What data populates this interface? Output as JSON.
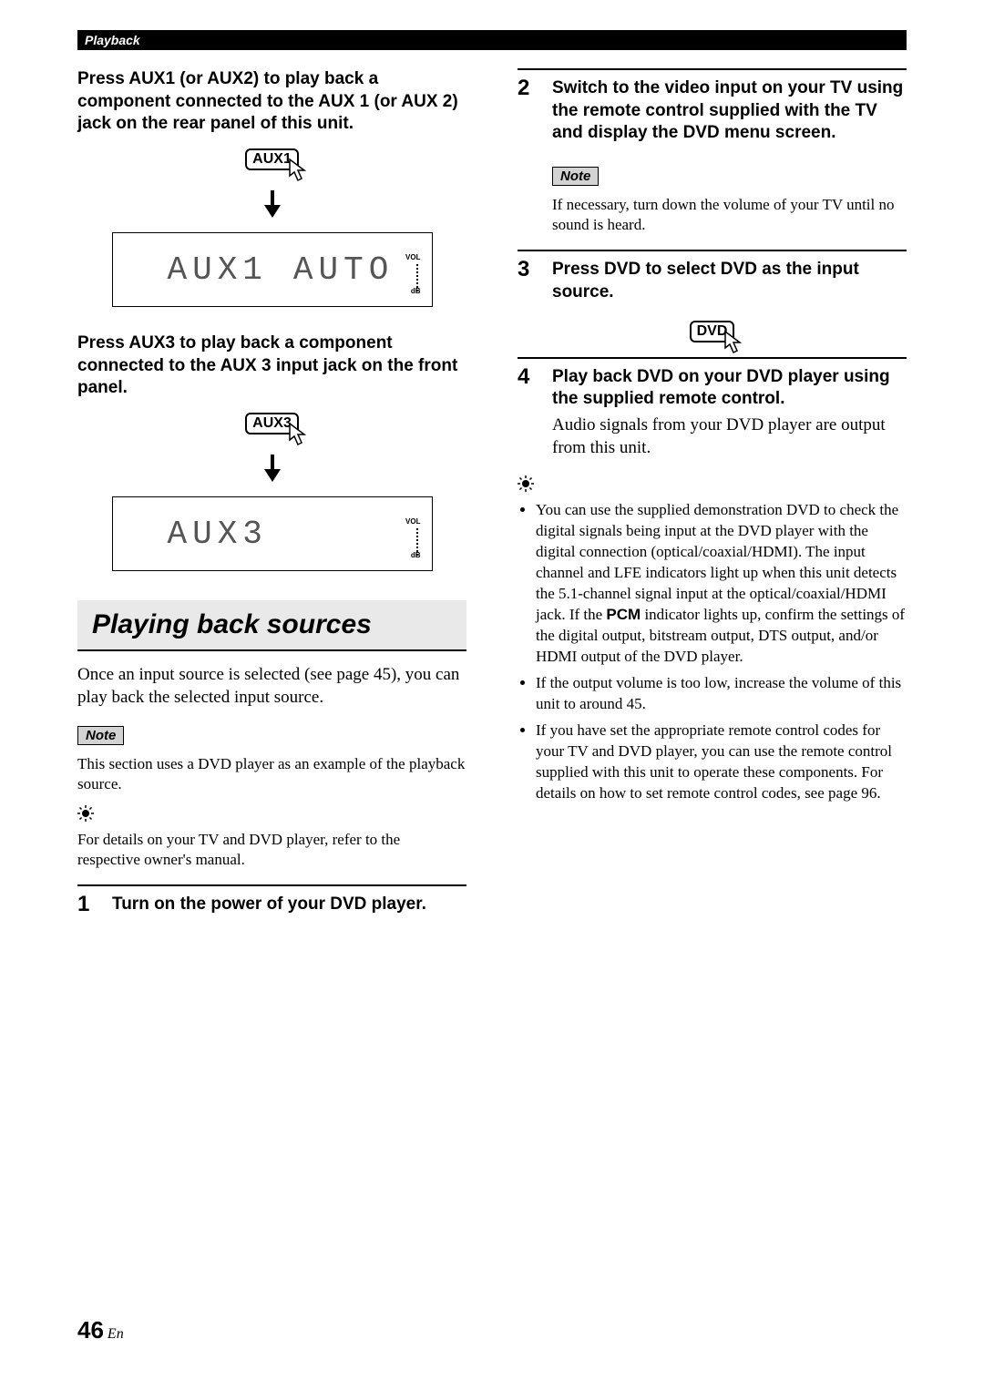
{
  "header": {
    "section": "Playback"
  },
  "left": {
    "instr1": "Press AUX1 (or AUX2) to play back a component connected to the AUX 1 (or AUX 2) jack on the rear panel of this unit.",
    "btn1": "AUX1",
    "disp1_a": "AUX1",
    "disp1_b": "AUTO",
    "vol_label": "VOL",
    "vol_db": "dB",
    "instr2": "Press AUX3 to play back a component connected to the AUX 3 input jack on the front panel.",
    "btn2": "AUX3",
    "disp2_a": "AUX3",
    "section_title": "Playing back sources",
    "intro": "Once an input source is selected (see page 45), you can play back the selected input source.",
    "note_label": "Note",
    "note_text": "This section uses a DVD player as an example of the playback source.",
    "tip_text": "For details on your TV and DVD player, refer to the respective owner's manual.",
    "step1_num": "1",
    "step1_text": "Turn on the power of your DVD player."
  },
  "right": {
    "step2_num": "2",
    "step2_text": "Switch to the video input on your TV using the remote control supplied with the TV and display the DVD menu screen.",
    "note_label": "Note",
    "note_text": "If necessary, turn down the volume of your TV until no sound is heard.",
    "step3_num": "3",
    "step3_text": "Press DVD to select DVD as the input source.",
    "btn_dvd": "DVD",
    "step4_num": "4",
    "step4_text": "Play back DVD on your DVD player using the supplied remote control.",
    "step4_sub": "Audio signals from your DVD player are output from this unit.",
    "tips": [
      {
        "pre": "You can use the supplied demonstration DVD to check the digital signals being input at the DVD player with the digital connection (optical/coaxial/HDMI). The input channel and LFE indicators light up when this unit detects the 5.1-channel signal input at the optical/coaxial/HDMI jack. If the ",
        "pcm": "PCM",
        "post": " indicator lights up, confirm the settings of the digital output, bitstream output, DTS output, and/or HDMI output of the DVD player."
      },
      {
        "text": "If the output volume is too low, increase the volume of this unit to around 45."
      },
      {
        "text": "If you have set the appropriate remote control codes for your TV and DVD player, you can use the remote control supplied with this unit to operate these components. For details on how to set remote control codes, see page 96."
      }
    ]
  },
  "footer": {
    "page_num": "46",
    "lang": "En"
  }
}
